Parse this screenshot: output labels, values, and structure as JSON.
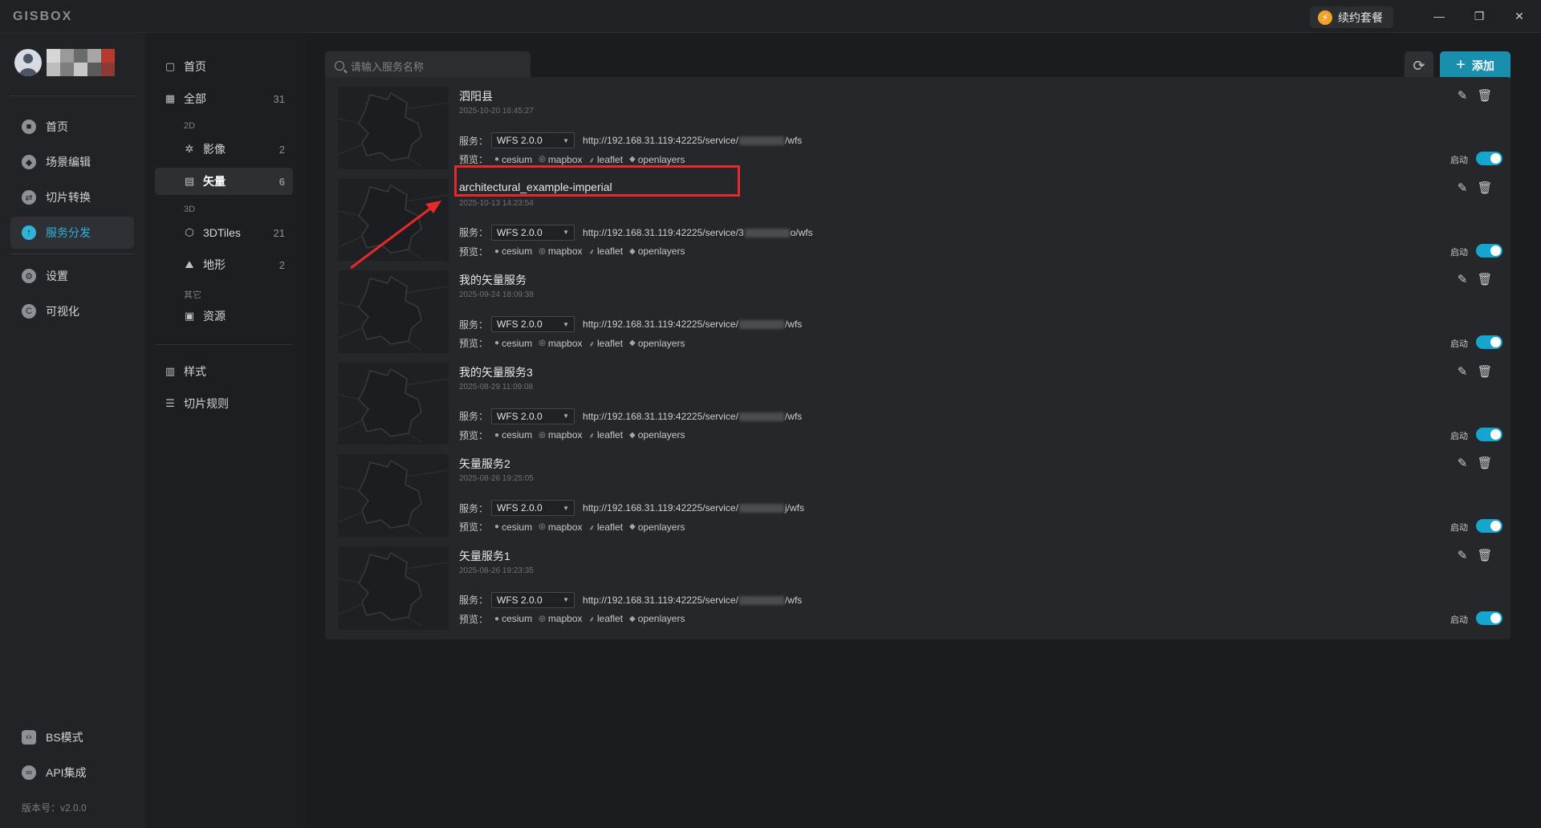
{
  "app": {
    "logo": "GISBOX",
    "renew_label": "续约套餐",
    "version": "版本号：v2.0.0"
  },
  "sidebar": {
    "items": [
      {
        "label": "首页",
        "icon": "home-icon"
      },
      {
        "label": "场景编辑",
        "icon": "cube-icon"
      },
      {
        "label": "切片转换",
        "icon": "swap-icon"
      },
      {
        "label": "服务分发",
        "icon": "upload-icon",
        "active": true
      },
      {
        "label": "设置",
        "icon": "gear-icon"
      },
      {
        "label": "可视化",
        "icon": "chart-icon"
      },
      {
        "label": "BS模式",
        "icon": "code-icon"
      },
      {
        "label": "API集成",
        "icon": "link-icon"
      }
    ]
  },
  "categories": {
    "home": "首页",
    "all": {
      "label": "全部",
      "count": "31"
    },
    "group_2d": "2D",
    "image": {
      "label": "影像",
      "count": "2"
    },
    "vector": {
      "label": "矢量",
      "count": "6"
    },
    "group_3d": "3D",
    "tiles3d": {
      "label": "3DTiles",
      "count": "21"
    },
    "terrain": {
      "label": "地形",
      "count": "2"
    },
    "group_other": "其它",
    "resource": {
      "label": "资源"
    },
    "style": "样式",
    "tile_rules": "切片规则"
  },
  "toolbar": {
    "search_placeholder": "请输入服务名称",
    "add_label": "添加"
  },
  "labels": {
    "service": "服务：",
    "preview": "预览：",
    "enabled": "启动"
  },
  "previews": [
    "cesium",
    "mapbox",
    "leaflet",
    "openlayers"
  ],
  "services": [
    {
      "name": "泗阳县",
      "date": "2025-10-20 16:45:27",
      "version": "WFS 2.0.0",
      "url_prefix": "http://192.168.31.119:42225/service/",
      "url_suffix": "/wfs",
      "enabled": true
    },
    {
      "name": "architectural_example-imperial",
      "date": "2025-10-13 14:23:54",
      "version": "WFS 2.0.0",
      "url_prefix": "http://192.168.31.119:42225/service/3",
      "url_suffix": "o/wfs",
      "enabled": true
    },
    {
      "name": "我的矢量服务",
      "date": "2025-09-24 18:09:38",
      "version": "WFS 2.0.0",
      "url_prefix": "http://192.168.31.119:42225/service/",
      "url_suffix": "/wfs",
      "enabled": true
    },
    {
      "name": "我的矢量服务3",
      "date": "2025-08-29 11:09:08",
      "version": "WFS 2.0.0",
      "url_prefix": "http://192.168.31.119:42225/service/",
      "url_suffix": "/wfs",
      "enabled": true
    },
    {
      "name": "矢量服务2",
      "date": "2025-08-26 19:25:05",
      "version": "WFS 2.0.0",
      "url_prefix": "http://192.168.31.119:42225/service/",
      "url_suffix": "j/wfs",
      "enabled": true
    },
    {
      "name": "矢量服务1",
      "date": "2025-08-26 19:23:35",
      "version": "WFS 2.0.0",
      "url_prefix": "http://192.168.31.119:42225/service/",
      "url_suffix": "/wfs",
      "enabled": true
    }
  ],
  "colors": {
    "accent": "#2fb3d9",
    "toggle_on": "#15a6d0",
    "add_button": "#1a8fad",
    "annotation": "#e52a2a"
  }
}
